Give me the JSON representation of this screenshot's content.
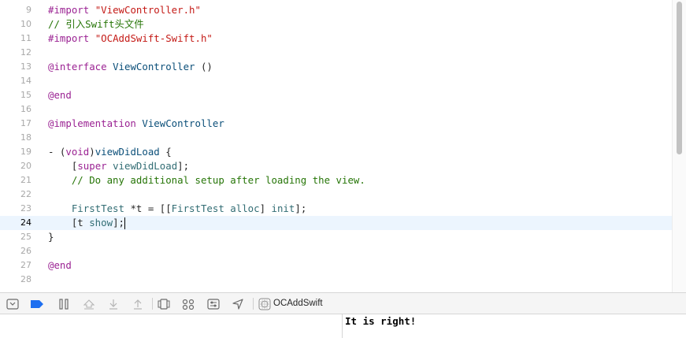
{
  "editor": {
    "current_line": 24,
    "lines": [
      {
        "num": "9",
        "tokens": [
          {
            "t": "#import ",
            "c": "t-kw"
          },
          {
            "t": "\"ViewController.h\"",
            "c": "t-str"
          }
        ]
      },
      {
        "num": "10",
        "tokens": [
          {
            "t": "// 引入Swift头文件",
            "c": "t-cmt"
          }
        ]
      },
      {
        "num": "11",
        "tokens": [
          {
            "t": "#import ",
            "c": "t-kw"
          },
          {
            "t": "\"OCAddSwift-Swift.h\"",
            "c": "t-str"
          }
        ]
      },
      {
        "num": "12",
        "tokens": []
      },
      {
        "num": "13",
        "tokens": [
          {
            "t": "@interface",
            "c": "t-kw"
          },
          {
            "t": " ",
            "c": "t-txt"
          },
          {
            "t": "ViewController",
            "c": "t-cls"
          },
          {
            "t": " ()",
            "c": "t-txt"
          }
        ]
      },
      {
        "num": "14",
        "tokens": []
      },
      {
        "num": "15",
        "tokens": [
          {
            "t": "@end",
            "c": "t-kw"
          }
        ]
      },
      {
        "num": "16",
        "tokens": []
      },
      {
        "num": "17",
        "tokens": [
          {
            "t": "@implementation",
            "c": "t-kw"
          },
          {
            "t": " ",
            "c": "t-txt"
          },
          {
            "t": "ViewController",
            "c": "t-cls"
          }
        ]
      },
      {
        "num": "18",
        "tokens": []
      },
      {
        "num": "19",
        "tokens": [
          {
            "t": "- (",
            "c": "t-txt"
          },
          {
            "t": "void",
            "c": "t-kw"
          },
          {
            "t": ")",
            "c": "t-txt"
          },
          {
            "t": "viewDidLoad",
            "c": "t-cls"
          },
          {
            "t": " {",
            "c": "t-txt"
          }
        ]
      },
      {
        "num": "20",
        "tokens": [
          {
            "t": "    [",
            "c": "t-txt"
          },
          {
            "t": "super",
            "c": "t-kw"
          },
          {
            "t": " ",
            "c": "t-txt"
          },
          {
            "t": "viewDidLoad",
            "c": "t-fn"
          },
          {
            "t": "];",
            "c": "t-txt"
          }
        ]
      },
      {
        "num": "21",
        "tokens": [
          {
            "t": "    // Do any additional setup after loading the view.",
            "c": "t-cmt"
          }
        ]
      },
      {
        "num": "22",
        "tokens": []
      },
      {
        "num": "23",
        "tokens": [
          {
            "t": "    ",
            "c": "t-txt"
          },
          {
            "t": "FirstTest",
            "c": "t-fn"
          },
          {
            "t": " *t = [[",
            "c": "t-txt"
          },
          {
            "t": "FirstTest",
            "c": "t-fn"
          },
          {
            "t": " ",
            "c": "t-txt"
          },
          {
            "t": "alloc",
            "c": "t-fn"
          },
          {
            "t": "] ",
            "c": "t-txt"
          },
          {
            "t": "init",
            "c": "t-fn"
          },
          {
            "t": "];",
            "c": "t-txt"
          }
        ]
      },
      {
        "num": "24",
        "tokens": [
          {
            "t": "    [t ",
            "c": "t-txt"
          },
          {
            "t": "show",
            "c": "t-fn"
          },
          {
            "t": "];",
            "c": "t-txt"
          }
        ],
        "caret": true
      },
      {
        "num": "25",
        "tokens": [
          {
            "t": "}",
            "c": "t-txt"
          }
        ]
      },
      {
        "num": "26",
        "tokens": []
      },
      {
        "num": "27",
        "tokens": [
          {
            "t": "@end",
            "c": "t-kw"
          }
        ]
      },
      {
        "num": "28",
        "tokens": []
      }
    ]
  },
  "debug_bar": {
    "buttons": [
      {
        "name": "hide-debug-area-icon",
        "interactable": true
      },
      {
        "name": "breakpoints-toggle-icon",
        "interactable": true
      },
      {
        "name": "pause-icon",
        "interactable": true
      },
      {
        "name": "step-over-icon",
        "interactable": true
      },
      {
        "name": "step-into-icon",
        "interactable": true
      },
      {
        "name": "step-out-icon",
        "interactable": true
      },
      {
        "name": "debug-view-hierarchy-icon",
        "interactable": true
      },
      {
        "name": "memory-graph-icon",
        "interactable": true
      },
      {
        "name": "environment-overrides-icon",
        "interactable": true
      },
      {
        "name": "simulate-location-icon",
        "interactable": true
      }
    ],
    "target_icon": "app-target-icon",
    "target_label": "OCAddSwift"
  },
  "console": {
    "output": "It is right!"
  },
  "colors": {
    "keyword": "#9b2393",
    "string": "#c41a16",
    "comment": "#267507",
    "current_line_bg": "#ecf5fe",
    "breakpoint_toggle": "#1e6ff0"
  }
}
